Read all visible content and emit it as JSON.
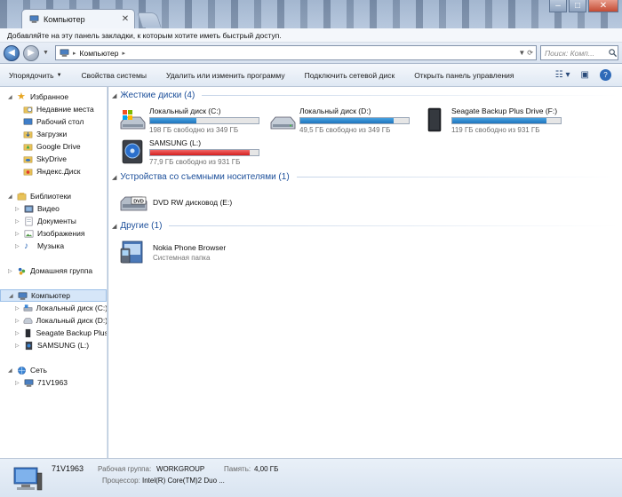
{
  "window": {
    "tab_title": "Компьютер",
    "bookmark_prompt": "Добавляйте на эту панель закладки, к которым хотите иметь быстрый доступ.",
    "address_crumb": "Компьютер",
    "search_placeholder": "Поиск: Комп..."
  },
  "toolbar": {
    "organize": "Упорядочить",
    "system_props": "Свойства системы",
    "uninstall": "Удалить или изменить программу",
    "map_drive": "Подключить сетевой диск",
    "control_panel": "Открыть панель управления"
  },
  "sidebar": {
    "favorites": {
      "title": "Избранное",
      "items": [
        "Недавние места",
        "Рабочий стол",
        "Загрузки",
        "Google Drive",
        "SkyDrive",
        "Яндекс.Диск"
      ]
    },
    "libraries": {
      "title": "Библиотеки",
      "items": [
        "Видео",
        "Документы",
        "Изображения",
        "Музыка"
      ]
    },
    "homegroup": "Домашняя группа",
    "computer": {
      "title": "Компьютер",
      "items": [
        "Локальный диск (C:)",
        "Локальный диск (D:)",
        "Seagate Backup Plus Drive (F:)",
        "SAMSUNG (L:)"
      ]
    },
    "network": {
      "title": "Сеть",
      "items": [
        "71V1963"
      ]
    }
  },
  "main": {
    "hard_drives_header": "Жесткие диски (4)",
    "drives": [
      {
        "name": "Локальный диск (C:)",
        "free": "198 ГБ свободно из 349 ГБ",
        "used_fraction": 0.43,
        "warn": false
      },
      {
        "name": "Локальный диск (D:)",
        "free": "49,5 ГБ свободно из 349 ГБ",
        "used_fraction": 0.86,
        "warn": false
      },
      {
        "name": "Seagate Backup Plus Drive (F:)",
        "free": "119 ГБ свободно из 931 ГБ",
        "used_fraction": 0.87,
        "warn": false
      },
      {
        "name": "SAMSUNG (L:)",
        "free": "77,9 ГБ свободно из 931 ГБ",
        "used_fraction": 0.92,
        "warn": true
      }
    ],
    "removable_header": "Устройства со съемными носителями (1)",
    "dvd": {
      "name": "DVD RW дисковод (E:)",
      "badge": "DVD"
    },
    "other_header": "Другие (1)",
    "other_item": {
      "name": "Nokia Phone Browser",
      "sub": "Системная папка"
    }
  },
  "details": {
    "computer_name": "71V1963",
    "workgroup_label": "Рабочая группа:",
    "workgroup_value": "WORKGROUP",
    "memory_label": "Память:",
    "memory_value": "4,00 ГБ",
    "cpu_label": "Процессор:",
    "cpu_value": "Intel(R) Core(TM)2 Duo ..."
  },
  "colors": {
    "link_blue": "#1c4f9a",
    "bar_blue": "#2a86cf",
    "bar_red": "#d41e1e",
    "selection": "#d6e6f8"
  }
}
